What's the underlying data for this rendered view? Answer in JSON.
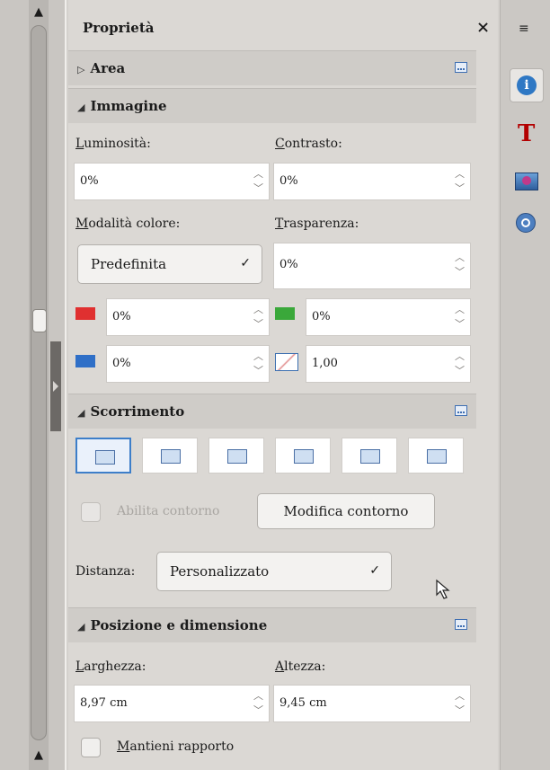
{
  "panel": {
    "title": "Proprietà",
    "close_label": "×"
  },
  "sections": {
    "area": {
      "label": "Area"
    },
    "immagine": {
      "label": "Immagine"
    },
    "scorrimento": {
      "label": "Scorrimento"
    },
    "posizione": {
      "label": "Posizione e dimensione"
    }
  },
  "image": {
    "brightness": {
      "label_initial": "L",
      "label_rest": "uminosità:",
      "value": "0%"
    },
    "contrast": {
      "label_initial": "C",
      "label_rest": "ontrasto:",
      "value": "0%"
    },
    "color_mode": {
      "label_initial": "M",
      "label_rest": "odalità colore:",
      "value": "Predefinita"
    },
    "transparency": {
      "label_initial": "T",
      "label_rest": "rasparenza:",
      "value": "0%"
    },
    "red": {
      "value": "0%"
    },
    "green": {
      "value": "0%"
    },
    "blue": {
      "value": "0%"
    },
    "gamma": {
      "value": "1,00"
    }
  },
  "wrap": {
    "enable_contour_label": "Abilita contorno",
    "edit_contour_label": "Modifica contorno",
    "distance_label": "Distanza:",
    "distance_value": "Personalizzato"
  },
  "position": {
    "width": {
      "label_initial": "L",
      "label_rest": "arghezza:",
      "value": "8,97 cm"
    },
    "height": {
      "label_initial": "A",
      "label_rest": "ltezza:",
      "value": "9,45 cm"
    },
    "keep_ratio_initial": "M",
    "keep_ratio_rest": "antieni rapporto"
  },
  "icons": {
    "spin_up": "^",
    "spin_down": "v",
    "chevron": "⌄",
    "expand": "▷",
    "collapse": "◢"
  },
  "colors": {
    "panel_bg": "#dbd8d4",
    "section_bg": "#cfccc8",
    "accent": "#3d7ec9",
    "red_swatch": "#e03030",
    "green_swatch": "#3aa83a",
    "blue_swatch": "#2f6fc7"
  }
}
